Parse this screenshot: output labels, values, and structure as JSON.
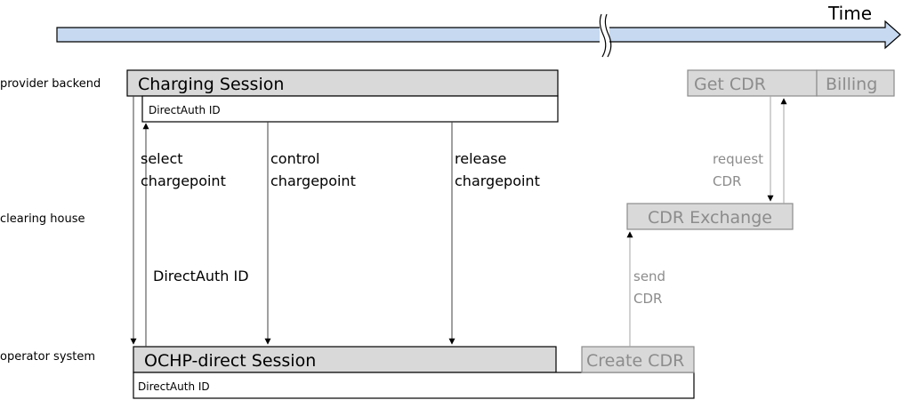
{
  "time_axis": {
    "label": "Time"
  },
  "lanes": {
    "provider": "provider backend",
    "clearing": "clearing house",
    "operator": "operator system"
  },
  "boxes": {
    "charging_session": "Charging Session",
    "charging_directauth": "DirectAuth ID",
    "ocph_session": "OCHP-direct Session",
    "ocph_directauth": "DirectAuth ID",
    "get_cdr": "Get CDR",
    "billing": "Billing",
    "cdr_exchange": "CDR Exchange",
    "create_cdr": "Create CDR"
  },
  "labels": {
    "select_1": "select",
    "select_2": "chargepoint",
    "control_1": "control",
    "control_2": "chargepoint",
    "release_1": "release",
    "release_2": "chargepoint",
    "directauth": "DirectAuth ID",
    "request_1": "request",
    "request_2": "CDR",
    "send_1": "send",
    "send_2": "CDR"
  },
  "colors": {
    "timeline_fill": "#c6d9f1",
    "box_fill": "#d9d9d9",
    "inactive_text": "#8c8c8c"
  }
}
